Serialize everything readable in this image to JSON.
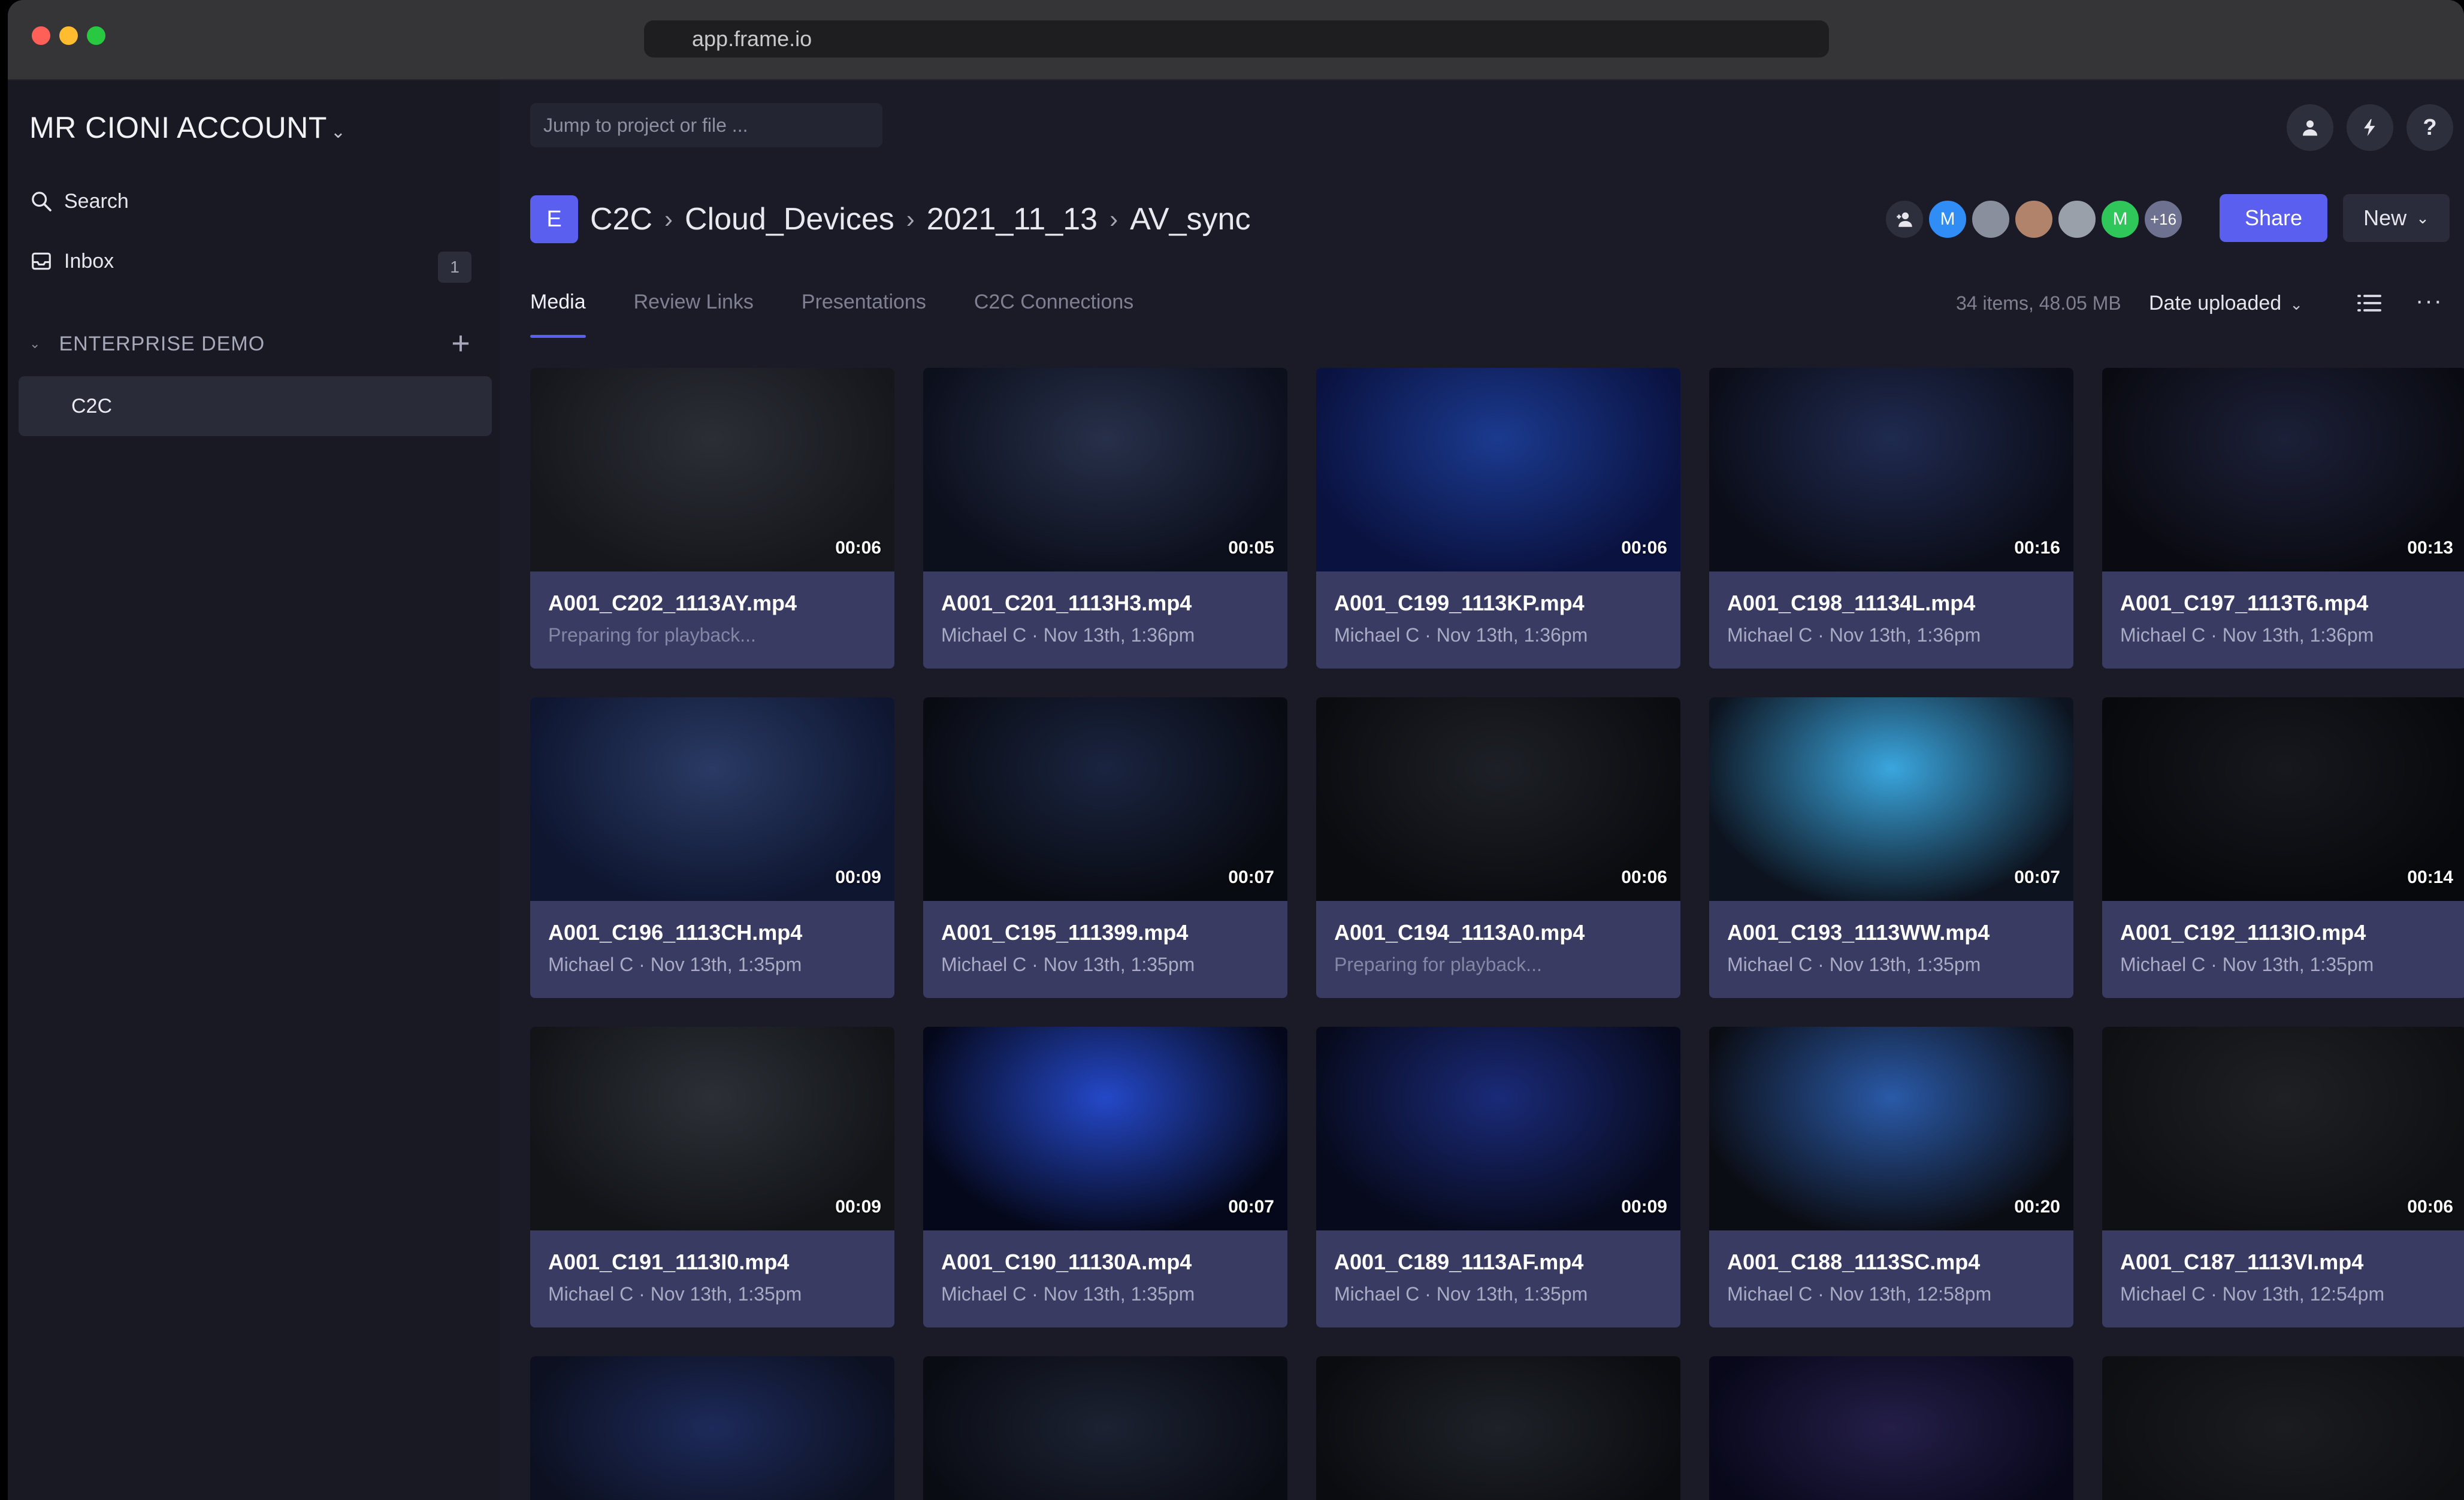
{
  "browser": {
    "url": "app.frame.io"
  },
  "sidebar": {
    "account": "MR CIONI ACCOUNT",
    "search_label": "Search",
    "inbox_label": "Inbox",
    "inbox_count": "1",
    "team": "ENTERPRISE DEMO",
    "projects": [
      "C2C"
    ]
  },
  "topbar": {
    "jump_placeholder": "Jump to project or file ..."
  },
  "project": {
    "avatar_letter": "E",
    "breadcrumb": [
      "C2C",
      "Cloud_Devices",
      "2021_11_13",
      "AV_sync"
    ],
    "collaborators": [
      {
        "initial": "M",
        "color": "#2f8df5"
      },
      {
        "initial": "",
        "color": "#8a8f9e"
      },
      {
        "initial": "",
        "color": "#b0836a"
      },
      {
        "initial": "",
        "color": "#9aa0aa"
      },
      {
        "initial": "M",
        "color": "#2fc65a"
      }
    ],
    "more_collaborators": "+16",
    "share_label": "Share",
    "new_label": "New"
  },
  "tabs": [
    "Media",
    "Review Links",
    "Presentations",
    "C2C Connections"
  ],
  "toolbar": {
    "count": "34 items, 48.05 MB",
    "sort_label": "Date uploaded"
  },
  "files": [
    {
      "name": "A001_C202_1113AY.mp4",
      "sub": "Preparing for playback...",
      "duration": "00:06",
      "preparing": true,
      "tone": [
        "#15171c",
        "#2b2e35"
      ]
    },
    {
      "name": "A001_C201_1113H3.mp4",
      "sub": "Michael C · Nov 13th, 1:36pm",
      "duration": "00:05",
      "tone": [
        "#0c0f1c",
        "#27304a"
      ]
    },
    {
      "name": "A001_C199_1113KP.mp4",
      "sub": "Michael C · Nov 13th, 1:36pm",
      "duration": "00:06",
      "tone": [
        "#0a1240",
        "#1b3a8f"
      ]
    },
    {
      "name": "A001_C198_11134L.mp4",
      "sub": "Michael C · Nov 13th, 1:36pm",
      "duration": "00:16",
      "tone": [
        "#0b0d18",
        "#1f2a50"
      ]
    },
    {
      "name": "A001_C197_1113T6.mp4",
      "sub": "Michael C · Nov 13th, 1:36pm",
      "duration": "00:13",
      "tone": [
        "#0a0b12",
        "#1c2038"
      ]
    },
    {
      "name": "A001_C196_1113CH.mp4",
      "sub": "Michael C · Nov 13th, 1:35pm",
      "duration": "00:09",
      "tone": [
        "#0e1630",
        "#2a3a64"
      ]
    },
    {
      "name": "A001_C195_111399.mp4",
      "sub": "Michael C · Nov 13th, 1:35pm",
      "duration": "00:07",
      "tone": [
        "#090b12",
        "#1a2440"
      ]
    },
    {
      "name": "A001_C194_1113A0.mp4",
      "sub": "Preparing for playback...",
      "duration": "00:06",
      "preparing": true,
      "tone": [
        "#0b0c10",
        "#1d2026"
      ]
    },
    {
      "name": "A001_C193_1113WW.mp4",
      "sub": "Michael C · Nov 13th, 1:35pm",
      "duration": "00:07",
      "tone": [
        "#0d1420",
        "#3aa6de"
      ]
    },
    {
      "name": "A001_C192_1113IO.mp4",
      "sub": "Michael C · Nov 13th, 1:35pm",
      "duration": "00:14",
      "tone": [
        "#08090c",
        "#16181e"
      ]
    },
    {
      "name": "A001_C191_1113I0.mp4",
      "sub": "Michael C · Nov 13th, 1:35pm",
      "duration": "00:09",
      "tone": [
        "#121418",
        "#2c3036"
      ]
    },
    {
      "name": "A001_C190_11130A.mp4",
      "sub": "Michael C · Nov 13th, 1:35pm",
      "duration": "00:07",
      "tone": [
        "#05081a",
        "#2448c8"
      ]
    },
    {
      "name": "A001_C189_1113AF.mp4",
      "sub": "Michael C · Nov 13th, 1:35pm",
      "duration": "00:09",
      "tone": [
        "#070a1c",
        "#1a2a78"
      ]
    },
    {
      "name": "A001_C188_1113SC.mp4",
      "sub": "Michael C · Nov 13th, 12:58pm",
      "duration": "00:20",
      "tone": [
        "#0b0d14",
        "#2a5aa8"
      ]
    },
    {
      "name": "A001_C187_1113VI.mp4",
      "sub": "Michael C · Nov 13th, 12:54pm",
      "duration": "00:06",
      "tone": [
        "#0f1013",
        "#1e2024"
      ]
    }
  ],
  "partial_row_tones": [
    [
      "#0c1020",
      "#1d2a5a"
    ],
    [
      "#0a0c14",
      "#1c2232"
    ],
    [
      "#0b0c10",
      "#1e2228"
    ],
    [
      "#08081a",
      "#241e48"
    ],
    [
      "#0e0f12",
      "#1b1c20"
    ]
  ]
}
